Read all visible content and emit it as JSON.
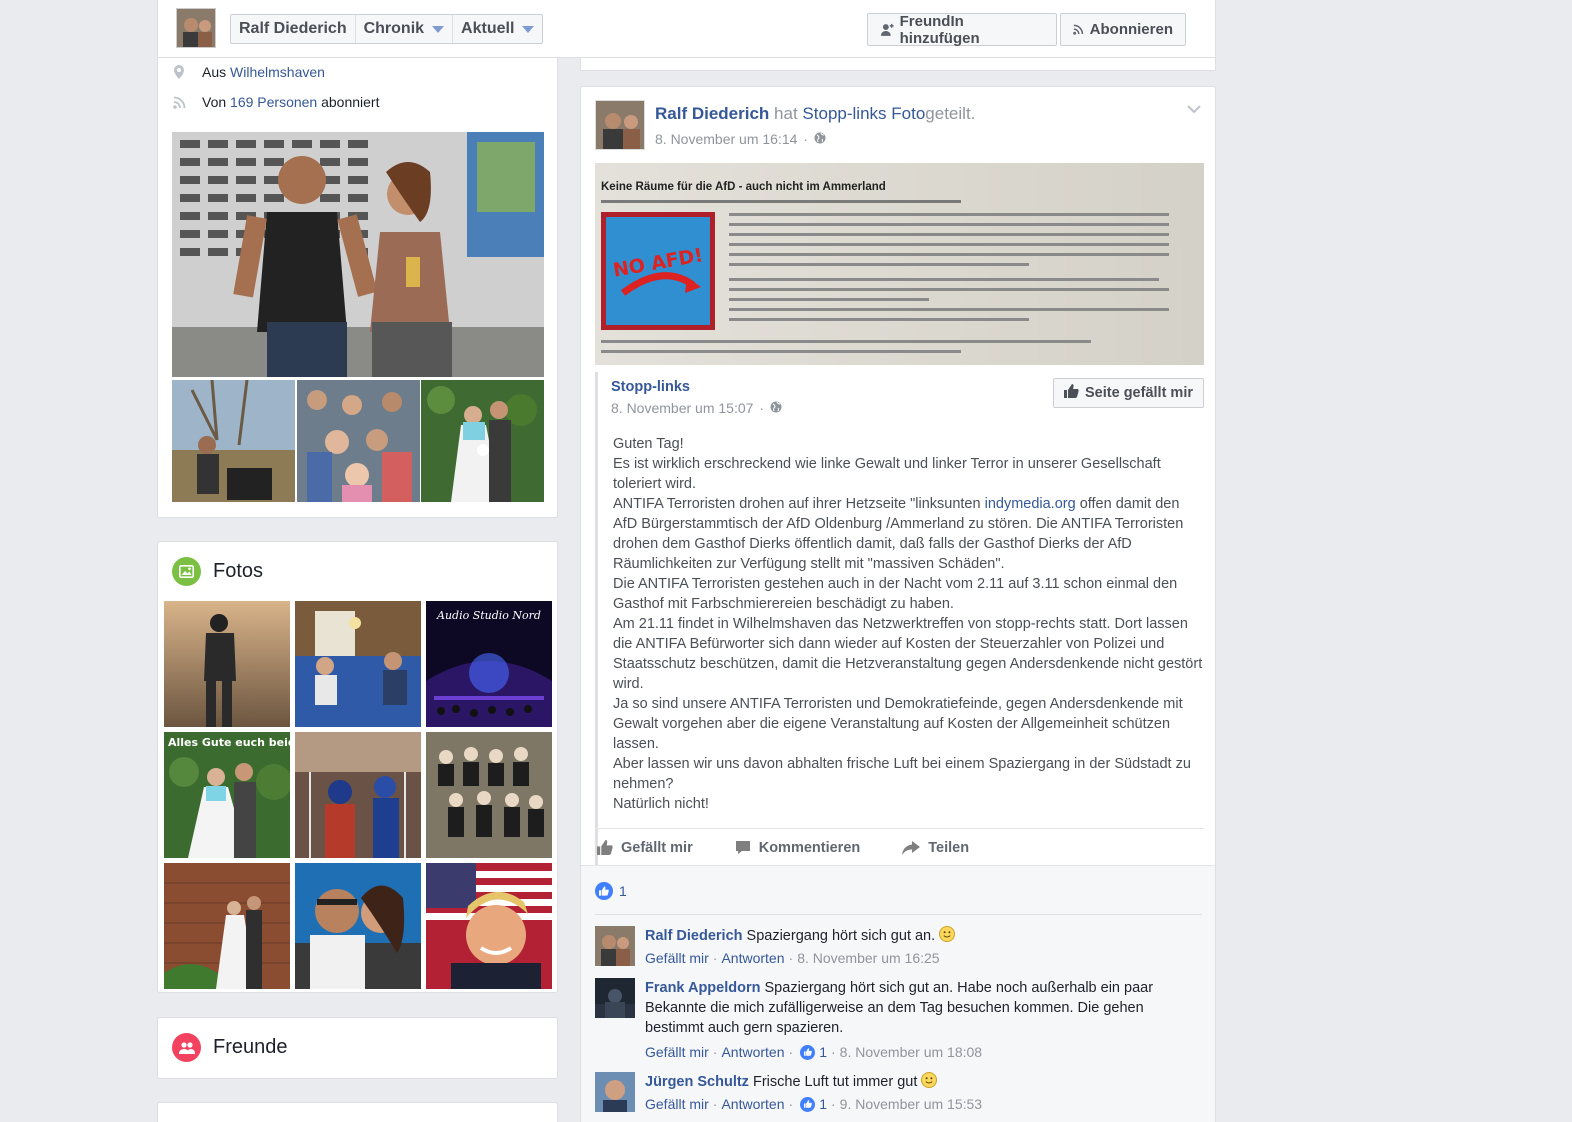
{
  "header": {
    "name": "Ralf Diederich",
    "tabs": [
      "Chronik",
      "Aktuell"
    ],
    "add_friend": "FreundIn hinzufügen",
    "subscribe": "Abonnieren"
  },
  "intro": {
    "from_prefix": "Aus",
    "from_city": "Wilhelmshaven",
    "followed_prefix": "Von",
    "followed_count": "169 Personen",
    "followed_suffix": "abonniert"
  },
  "sections": {
    "fotos": "Fotos",
    "freunde": "Freunde",
    "foto_captions": {
      "audio": "Audio Studio Nord",
      "wedding": "Alles Gute euch beiden"
    }
  },
  "post": {
    "author": "Ralf Diederich",
    "verb": "hat",
    "shared_source": "Stopp-links",
    "shared_object": "Foto",
    "suffix": "geteilt.",
    "timestamp": "8. November um 16:14",
    "shared_image": {
      "title": "Keine Räume für die AfD - auch nicht im Ammerland",
      "sign": "NO AFD!"
    },
    "page_name": "Stopp-links",
    "page_time": "8. November um 15:07",
    "like_page": "Seite gefällt mir",
    "text_before_link": "Guten Tag!\nEs ist wirklich erschreckend wie linke Gewalt und linker Terror in unserer Gesellschaft toleriert wird.\nANTIFA Terroristen drohen auf ihrer Hetzseite \"linksunten ",
    "text_link": "indymedia.org",
    "text_after_link": " offen damit den AfD Bürgerstammtisch der AfD Oldenburg /Ammerland zu stören. Die ANTIFA Terroristen drohen dem Gasthof Dierks öffentlich damit, daß falls der Gasthof Dierks der AfD Räumlichkeiten zur Verfügung stellt mit \"massiven Schäden\".\nDie ANTIFA Terroristen gestehen auch in der Nacht vom 2.11 auf 3.11 schon einmal den Gasthof mit Farbschmierereien beschädigt zu haben.\nAm 21.11 findet in Wilhelmshaven das Netzwerktreffen von stopp-rechts statt. Dort lassen die ANTIFA Befürworter sich dann wieder auf Kosten der Steuerzahler von Polizei und Staatsschutz beschützen, damit die Hetzveranstaltung gegen Andersdenkende nicht gestört wird.\nJa so sind unsere ANTIFA Terroristen und Demokratiefeinde, gegen Andersdenkende mit Gewalt vorgehen aber die eigene Veranstaltung auf Kosten der Allgemeinheit schützen lassen.\nAber lassen wir uns davon abhalten frische Luft bei einem Spaziergang in der Südstadt zu nehmen?\nNatürlich nicht!",
    "actions": {
      "like": "Gefällt mir",
      "comment": "Kommentieren",
      "share": "Teilen"
    },
    "like_count": "1"
  },
  "comments": [
    {
      "name": "Ralf Diederich",
      "text": "Spaziergang hört sich gut an.",
      "smiley": true,
      "like": "Gefällt mir",
      "reply": "Antworten",
      "likes": "",
      "time": "8. November um 16:25"
    },
    {
      "name": "Frank Appeldorn",
      "text": "Spaziergang hört sich gut an. Habe noch außerhalb ein paar Bekannte die mich zufälligerweise an dem Tag besuchen kommen. Die gehen bestimmt auch gern spazieren.",
      "smiley": false,
      "like": "Gefällt mir",
      "reply": "Antworten",
      "likes": "1",
      "time": "8. November um 18:08"
    },
    {
      "name": "Jürgen Schultz",
      "text": "Frische Luft tut immer gut",
      "smiley": true,
      "like": "Gefällt mir",
      "reply": "Antworten",
      "likes": "1",
      "time": "9. November um 15:53"
    }
  ],
  "colors": {
    "brand": "#365899",
    "like_blue": "#4080ff",
    "page_bg": "#e9ebee"
  }
}
